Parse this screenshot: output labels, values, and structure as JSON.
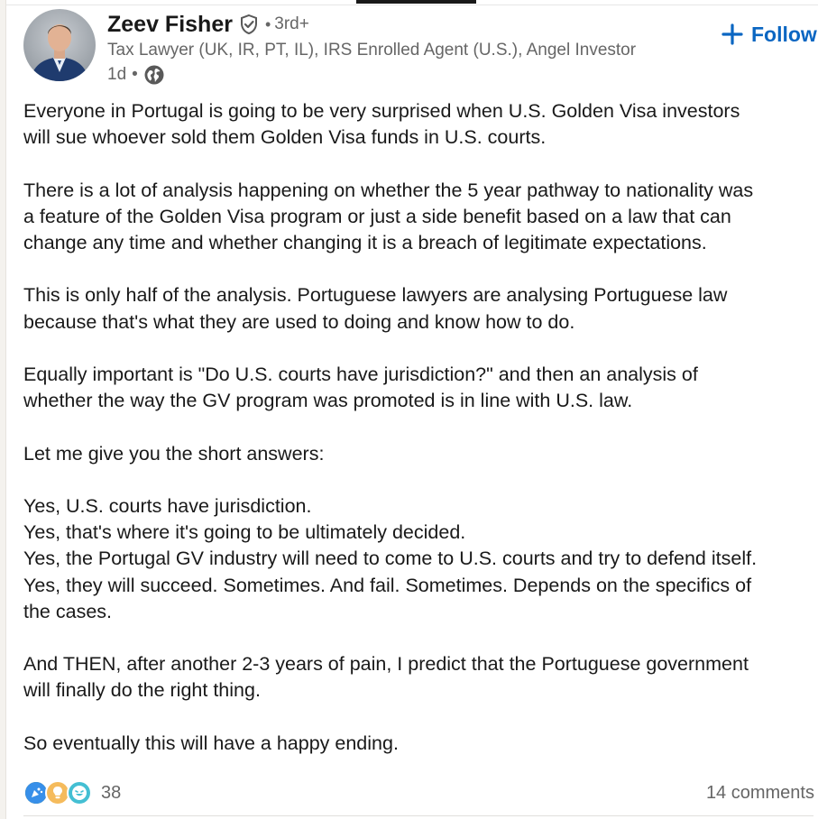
{
  "author": {
    "name": "Zeev Fisher",
    "degree": "3rd+",
    "separator": "•",
    "headline": "Tax Lawyer (UK, IR, PT, IL), IRS Enrolled Agent (U.S.), Angel Investor",
    "time": "1d",
    "visibility_icon": "globe-icon",
    "verified_icon": "verified-shield-icon",
    "avatar_icon": "profile-photo"
  },
  "follow": {
    "label": "Follow",
    "icon": "plus-icon",
    "color": "#0a66c2"
  },
  "post": {
    "paragraphs": [
      "Everyone in Portugal is going to be very surprised when U.S. Golden Visa investors\nwill sue whoever sold them Golden Visa funds in U.S. courts.",
      "There is a lot of analysis happening on whether the 5 year pathway to nationality was\na feature of the Golden Visa program or just a side benefit based on a law that can\nchange any time and whether changing it is a breach of legitimate expectations.",
      "This is only half of the analysis. Portuguese lawyers are analysing Portuguese law\nbecause that's what they are used to doing and know how to do.",
      "Equally important is \"Do U.S. courts have jurisdiction?\" and then an analysis of\nwhether the way the GV program was promoted is in line with U.S. law.",
      "Let me give you the short answers:",
      "Yes, U.S. courts have jurisdiction.\nYes, that's where it's going to be ultimately decided.\nYes, the Portugal GV industry will need to come to U.S. courts and try to defend itself.\nYes, they will succeed. Sometimes. And fail. Sometimes. Depends on the specifics of\nthe cases.",
      "And THEN, after another 2-3 years of pain, I predict that the Portuguese government\nwill finally do the right thing.",
      "So eventually this will have a happy ending."
    ]
  },
  "social": {
    "reaction_icons": [
      "celebrate-icon",
      "insightful-icon",
      "funny-icon"
    ],
    "reaction_count": "38",
    "comments": "14 comments"
  },
  "colors": {
    "text": "#191919",
    "muted": "#666666",
    "link": "#0a66c2"
  }
}
